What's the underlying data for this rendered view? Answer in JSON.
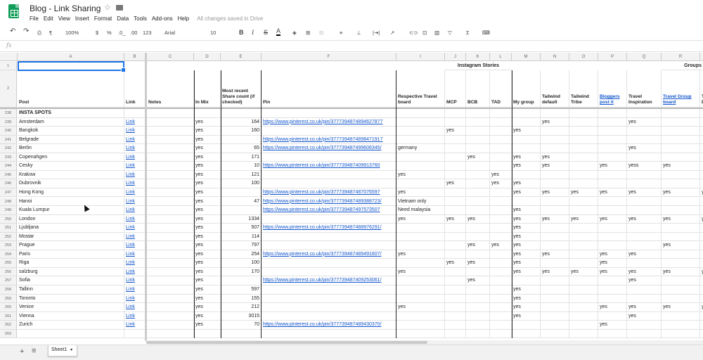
{
  "app": {
    "doc_title": "Blog - Link Sharing",
    "saved_status": "All changes saved in Drive",
    "menus": [
      "File",
      "Edit",
      "View",
      "Insert",
      "Format",
      "Data",
      "Tools",
      "Add-ons",
      "Help"
    ]
  },
  "toolbar": {
    "zoom": "100%",
    "currency": "$",
    "percent": "%",
    "dec_less": ".0_",
    "dec_more": ".00",
    "format_more": "123",
    "font": "Arial",
    "font_size": "10",
    "bold": "B",
    "italic": "I",
    "strike": "S",
    "text_color": "A"
  },
  "fx_label": "fx",
  "columns": [
    "A",
    "B",
    "C",
    "D",
    "E",
    "F",
    "I",
    "J",
    "K",
    "L",
    "M",
    "N",
    "O",
    "P",
    "Q",
    "R"
  ],
  "group_headers": {
    "instagram": "Instagram Stories",
    "groups": "Groups"
  },
  "headers": {
    "post": "Post",
    "link": "Link",
    "notes": "Notes",
    "in_mix": "In Mix",
    "share_count": "Most recent Share count (if checked)",
    "pin": "Pin",
    "board": "Respective Travel board",
    "mcp": "MCP",
    "bcb": "BCB",
    "tad": "TAD",
    "my_group": "My group",
    "tailwind_default": "Tailwind default",
    "tailwind_tribe": "Tailwind Tribe",
    "bloggers_post": "Bloggers post it",
    "travel_inspiration": "Travel Inspiration",
    "travel_group_board": "Travel Group board",
    "partial": "T D"
  },
  "row_labels": {
    "r1": "1",
    "r2": "2",
    "section": "238",
    "last": "263"
  },
  "section_title": "INSTA SPOTS",
  "rows": [
    {
      "n": "239",
      "post": "Amsterdam",
      "link": "Link",
      "mix": "yes",
      "share": "164",
      "pin": "https://www.pinterest.co.uk/pin/3777394874894627877",
      "board": "",
      "mcp": "",
      "bcb": "",
      "tad": "",
      "my": "",
      "twd": "yes",
      "twt": "",
      "bpi": "",
      "ti": "yes",
      "tgb": "",
      "s": ""
    },
    {
      "n": "240",
      "post": "Bangkok",
      "link": "Link",
      "mix": "yes",
      "share": "160",
      "pin": "",
      "board": "",
      "mcp": "yes",
      "bcb": "",
      "tad": "",
      "my": "yes",
      "twd": "",
      "twt": "",
      "bpi": "",
      "ti": "",
      "tgb": "",
      "s": ""
    },
    {
      "n": "241",
      "post": "Belgrade",
      "link": "Link",
      "mix": "yes",
      "share": "",
      "pin": "https://www.pinterest.co.uk/pin/3777394874898471917",
      "board": "",
      "mcp": "",
      "bcb": "",
      "tad": "",
      "my": "",
      "twd": "",
      "twt": "",
      "bpi": "",
      "ti": "",
      "tgb": "",
      "s": ""
    },
    {
      "n": "242",
      "post": "Berlin",
      "link": "Link",
      "mix": "yes",
      "share": "65",
      "pin": "https://www.pinterest.co.uk/pin/377739487499606345/",
      "board": "germany",
      "mcp": "",
      "bcb": "",
      "tad": "",
      "my": "",
      "twd": "",
      "twt": "",
      "bpi": "",
      "ti": "yes",
      "tgb": "",
      "s": ""
    },
    {
      "n": "243",
      "post": "Copenahgen",
      "link": "Link",
      "mix": "yes",
      "share": "171",
      "pin": "",
      "board": "",
      "mcp": "",
      "bcb": "yes",
      "tad": "",
      "my": "yes",
      "twd": "yes",
      "twt": "",
      "bpi": "",
      "ti": "",
      "tgb": "",
      "s": ""
    },
    {
      "n": "244",
      "post": "Cesky",
      "link": "Link",
      "mix": "yes",
      "share": "10",
      "pin": "https://www.pinterest.co.uk/pin/377739487409913760",
      "board": "",
      "mcp": "",
      "bcb": "",
      "tad": "",
      "my": "yes",
      "twd": "yes",
      "twt": "",
      "bpi": "yes",
      "ti": "yess",
      "tgb": "yes",
      "s": ""
    },
    {
      "n": "245",
      "post": "Krakow",
      "link": "Link",
      "mix": "yes",
      "share": "121",
      "pin": "",
      "board": "yes",
      "mcp": "",
      "bcb": "",
      "tad": "yes",
      "my": "",
      "twd": "",
      "twt": "",
      "bpi": "",
      "ti": "",
      "tgb": "",
      "s": ""
    },
    {
      "n": "246",
      "post": "Dubrovnik",
      "link": "Link",
      "mix": "yes",
      "share": "100",
      "pin": "",
      "board": "",
      "mcp": "yes",
      "bcb": "",
      "tad": "yes",
      "my": "yes",
      "twd": "",
      "twt": "",
      "bpi": "",
      "ti": "",
      "tgb": "",
      "s": ""
    },
    {
      "n": "247",
      "post": "Hong Kong",
      "link": "Link",
      "mix": "yes",
      "share": "",
      "pin": "https://www.pinterest.co.uk/pin/377739487487076597",
      "board": "yes",
      "mcp": "",
      "bcb": "",
      "tad": "",
      "my": "yes",
      "twd": "yes",
      "twt": "yes",
      "bpi": "yes",
      "ti": "yes",
      "tgb": "yes",
      "s": "y"
    },
    {
      "n": "248",
      "post": "Hanoi",
      "link": "Link",
      "mix": "yes",
      "share": "47",
      "pin": "https://www.pinterest.co.uk/pin/377739487489388723/",
      "board": "Vietnam only",
      "mcp": "",
      "bcb": "",
      "tad": "",
      "my": "",
      "twd": "",
      "twt": "",
      "bpi": "",
      "ti": "",
      "tgb": "",
      "s": ""
    },
    {
      "n": "249",
      "post": "Kuala Lumpur",
      "link": "Link",
      "mix": "yes",
      "share": "",
      "pin": "https://www.pinterest.co.uk/pin/377739487497573507",
      "board": "Need malaysia",
      "mcp": "",
      "bcb": "",
      "tad": "",
      "my": "yes",
      "twd": "",
      "twt": "",
      "bpi": "",
      "ti": "",
      "tgb": "",
      "s": ""
    },
    {
      "n": "250",
      "post": "London",
      "link": "Link",
      "mix": "yes",
      "share": "1334",
      "pin": "",
      "board": "yes",
      "mcp": "yes",
      "bcb": "yes",
      "tad": "",
      "my": "yes",
      "twd": "yes",
      "twt": "yes",
      "bpi": "yes",
      "ti": "yes",
      "tgb": "yes",
      "s": "y"
    },
    {
      "n": "251",
      "post": "Ljubljana",
      "link": "Link",
      "mix": "yes",
      "share": "507",
      "pin": "https://www.pinterest.co.uk/pin/377739487488976291/",
      "board": "",
      "mcp": "",
      "bcb": "",
      "tad": "",
      "my": "yes",
      "twd": "",
      "twt": "",
      "bpi": "",
      "ti": "",
      "tgb": "",
      "s": ""
    },
    {
      "n": "252",
      "post": "Mostar",
      "link": "Link",
      "mix": "yes",
      "share": "114",
      "pin": "",
      "board": "",
      "mcp": "",
      "bcb": "",
      "tad": "",
      "my": "yes",
      "twd": "",
      "twt": "",
      "bpi": "",
      "ti": "",
      "tgb": "",
      "s": ""
    },
    {
      "n": "253",
      "post": "Prague",
      "link": "Link",
      "mix": "yes",
      "share": "797",
      "pin": "",
      "board": "",
      "mcp": "",
      "bcb": "yes",
      "tad": "yes",
      "my": "yes",
      "twd": "",
      "twt": "",
      "bpi": "",
      "ti": "",
      "tgb": "yes",
      "s": ""
    },
    {
      "n": "254",
      "post": "Paris",
      "link": "Link",
      "mix": "yes",
      "share": "254",
      "pin": "https://www.pinterest.co.uk/pin/377739487489491607/",
      "board": "yes",
      "mcp": "",
      "bcb": "",
      "tad": "",
      "my": "yes",
      "twd": "yes",
      "twt": "",
      "bpi": "yes",
      "ti": "yes",
      "tgb": "",
      "s": ""
    },
    {
      "n": "255",
      "post": "Riga",
      "link": "Link",
      "mix": "yes",
      "share": "100",
      "pin": "",
      "board": "",
      "mcp": "yes",
      "bcb": "yes",
      "tad": "",
      "my": "yes",
      "twd": "",
      "twt": "",
      "bpi": "yes",
      "ti": "",
      "tgb": "",
      "s": ""
    },
    {
      "n": "256",
      "post": "salzburg",
      "link": "Link",
      "mix": "yes",
      "share": "170",
      "pin": "",
      "board": "yes",
      "mcp": "",
      "bcb": "",
      "tad": "",
      "my": "yes",
      "twd": "yes",
      "twt": "yes",
      "bpi": "yes",
      "ti": "yes",
      "tgb": "yes",
      "s": "y"
    },
    {
      "n": "257",
      "post": "Sofia",
      "link": "Link",
      "mix": "yes",
      "share": "",
      "pin": "https://www.pinterest.co.uk/pin/377739487409253061/",
      "board": "",
      "mcp": "",
      "bcb": "yes",
      "tad": "",
      "my": "",
      "twd": "",
      "twt": "",
      "bpi": "",
      "ti": "yes",
      "tgb": "",
      "s": ""
    },
    {
      "n": "258",
      "post": "Tallinn",
      "link": "Link",
      "mix": "yes",
      "share": "597",
      "pin": "",
      "board": "",
      "mcp": "",
      "bcb": "",
      "tad": "",
      "my": "yes",
      "twd": "",
      "twt": "",
      "bpi": "",
      "ti": "",
      "tgb": "",
      "s": ""
    },
    {
      "n": "259",
      "post": "Toronto",
      "link": "Link",
      "mix": "yes",
      "share": "155",
      "pin": "",
      "board": "",
      "mcp": "",
      "bcb": "",
      "tad": "",
      "my": "yes",
      "twd": "",
      "twt": "",
      "bpi": "",
      "ti": "",
      "tgb": "",
      "s": ""
    },
    {
      "n": "260",
      "post": "Venice",
      "link": "Link",
      "mix": "yes",
      "share": "212",
      "pin": "",
      "board": "yes",
      "mcp": "",
      "bcb": "",
      "tad": "",
      "my": "yes",
      "twd": "",
      "twt": "",
      "bpi": "yes",
      "ti": "yes",
      "tgb": "yes",
      "s": "y"
    },
    {
      "n": "261",
      "post": "Vienna",
      "link": "Link",
      "mix": "yes",
      "share": "3015",
      "pin": "",
      "board": "",
      "mcp": "",
      "bcb": "",
      "tad": "",
      "my": "yes",
      "twd": "",
      "twt": "",
      "bpi": "",
      "ti": "yes",
      "tgb": "",
      "s": ""
    },
    {
      "n": "262",
      "post": "Zurich",
      "link": "Link",
      "mix": "yes",
      "share": "70",
      "pin": "https://www.pinterest.co.uk/pin/377739487489430370/",
      "board": "",
      "mcp": "",
      "bcb": "",
      "tad": "",
      "my": "",
      "twd": "",
      "twt": "",
      "bpi": "yes",
      "ti": "",
      "tgb": "",
      "s": ""
    }
  ],
  "sheet_tab": "Sheet1",
  "colors": {
    "link": "#1155cc",
    "selection": "#1a73e8",
    "sheets_green": "#0f9d58"
  }
}
